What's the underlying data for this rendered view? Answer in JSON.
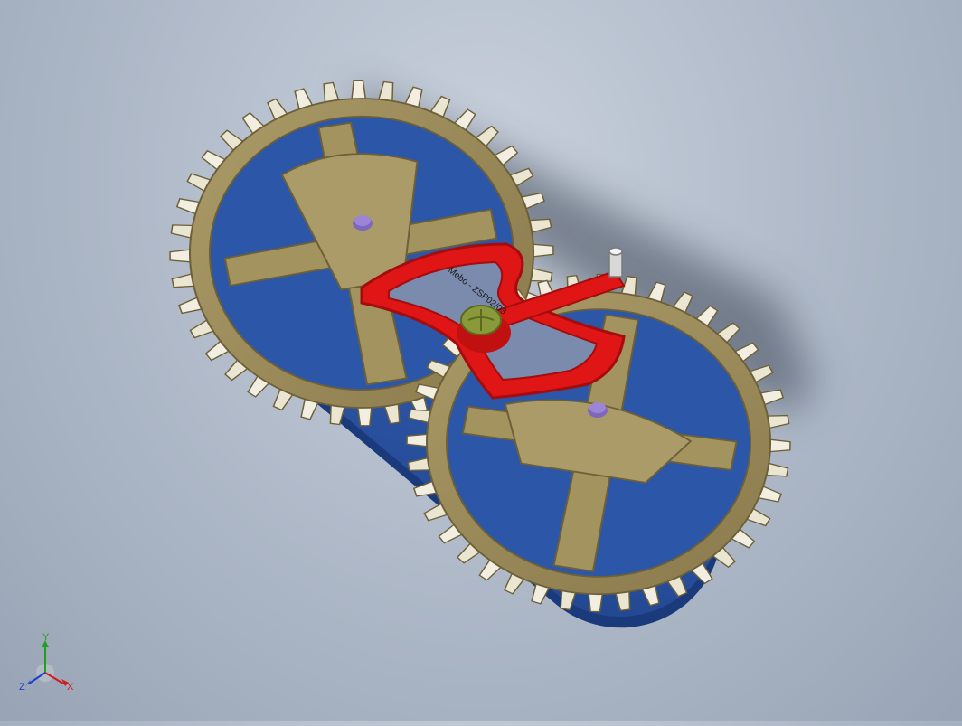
{
  "viewport": {
    "model": "gear escapement assembly",
    "background_top": "#c9d1dc",
    "background_bottom": "#98a4b5"
  },
  "colors": {
    "gear": "#9c8c5c",
    "gear_dark": "#7a6c42",
    "gear_tooth_top": "#f2efe2",
    "base_plate": "#2c56a8",
    "base_plate_dark": "#1e3f82",
    "lever": "#e01616",
    "lever_dark": "#a30d0d",
    "pivot_cap": "#8a9a3a",
    "pin": "#9c85d6"
  },
  "part_engraving": "Mebo - ZSP02/03",
  "triad": {
    "x_label": "X",
    "y_label": "Y",
    "z_label": "Z",
    "x_color": "#d21a1a",
    "y_color": "#1fa11f",
    "z_color": "#1c3fd0"
  }
}
